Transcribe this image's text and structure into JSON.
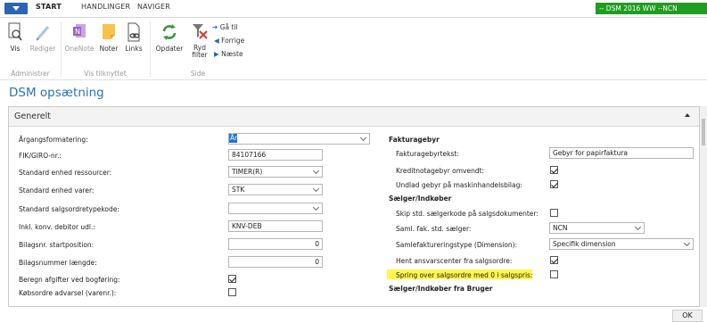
{
  "tabs": [
    "START",
    "HANDLINGER",
    "NAVIGER"
  ],
  "company_badge": "-- DSM 2016 WW --NCN",
  "ribbon": {
    "vis": "Vis",
    "rediger": "Rediger",
    "onenote": "OneNote",
    "noter": "Noter",
    "links": "Links",
    "opdater": "Opdater",
    "ryd_filter": "Ryd filter",
    "gaa_til": "Gå til",
    "forrige": "Forrige",
    "naeste": "Næste",
    "group_administrer": "Administrer",
    "group_vis_tilknyttet": "Vis tilknyttet",
    "group_side": "Side"
  },
  "page_title": "DSM opsætning",
  "fasttab_title": "Generelt",
  "left_fields": [
    {
      "label": "Årgangsformatering:",
      "value": "År",
      "kind": "select"
    },
    {
      "label": "FIK/GIRO-nr.:",
      "value": "84107166",
      "kind": "text"
    },
    {
      "label": "Standard enhed ressourcer:",
      "value": "TIMER(R)",
      "kind": "select"
    },
    {
      "label": "Standard enhed varer:",
      "value": "STK",
      "kind": "select"
    },
    {
      "label": "Standard salgsordretypekode:",
      "value": "",
      "kind": "select"
    },
    {
      "label": "Inkl. konv. debitor udl.:",
      "value": "KNV-DEB",
      "kind": "text"
    },
    {
      "label": "Bilagsnr. startposition:",
      "value": "0",
      "kind": "num"
    },
    {
      "label": "Bilagsnummer længde:",
      "value": "0",
      "kind": "num"
    },
    {
      "label": "Beregn afgifter ved bogføring:",
      "checked": true,
      "kind": "check"
    },
    {
      "label": "Købsordre advarsel (varenr.):",
      "checked": false,
      "kind": "check"
    }
  ],
  "right": {
    "section1": "Fakturagebyr",
    "fakturagebyrtekst_label": "Fakturagebyrtekst:",
    "fakturagebyrtekst_value": "Gebyr for papirfaktura",
    "kreditnota_label": "Kreditnotagebyr omvendt:",
    "kreditnota_checked": true,
    "undlad_label": "Undlad gebyr på maskinhandelsbilag:",
    "undlad_checked": true,
    "section2": "Sælger/Indkøber",
    "skip_label": "Skip std. sælgerkode på salgsdokumenter:",
    "skip_checked": false,
    "saml_label": "Saml. fak. std. sælger:",
    "saml_value": "NCN",
    "samlefak_label": "Samlefaktureringstype (Dimension):",
    "samlefak_value": "Specifik dimension",
    "hent_label": "Hent ansvarscenter fra salgsordre:",
    "hent_checked": true,
    "spring_label": "Spring over salgsordre med 0 i salgspris:",
    "spring_checked": false,
    "section3": "Sælger/Indkøber fra Bruger"
  },
  "ok_label": "OK",
  "colors": {
    "accent": "#2a72b8",
    "company_badge": "#1f9d1f",
    "highlight": "#fff74a"
  }
}
